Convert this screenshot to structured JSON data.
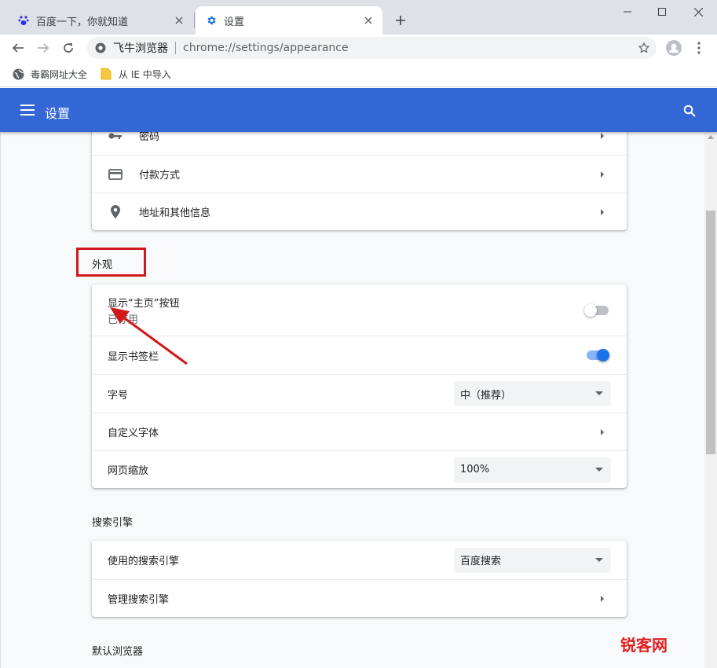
{
  "browser": {
    "tabs": [
      {
        "title": "百度一下，你就知道",
        "icon": "baidu-paw-icon",
        "active": false
      },
      {
        "title": "设置",
        "icon": "gear-icon",
        "active": true
      }
    ],
    "new_tab": "+",
    "omnibox": {
      "site_name": "飞牛浏览器",
      "url": "chrome://settings/appearance"
    },
    "bookmarks": [
      {
        "label": "毒霸网址大全",
        "icon": "globe-icon"
      },
      {
        "label": "从 IE 中导入",
        "icon": "folder-icon"
      }
    ]
  },
  "header": {
    "title": "设置",
    "accent_color": "#3367d6"
  },
  "autofill_card": {
    "rows": [
      {
        "label": "密码",
        "icon": "key-icon"
      },
      {
        "label": "付款方式",
        "icon": "credit-card-icon"
      },
      {
        "label": "地址和其他信息",
        "icon": "location-pin-icon"
      }
    ]
  },
  "appearance": {
    "section_title": "外观",
    "show_home_button": {
      "label": "显示“主页”按钮",
      "sublabel": "已停用",
      "enabled": false
    },
    "show_bookmarks_bar": {
      "label": "显示书签栏",
      "enabled": true
    },
    "font_size": {
      "label": "字号",
      "value": "中（推荐）"
    },
    "custom_fonts": {
      "label": "自定义字体"
    },
    "page_zoom": {
      "label": "网页缩放",
      "value": "100%"
    }
  },
  "search_engine": {
    "section_title": "搜索引擎",
    "engine": {
      "label": "使用的搜索引擎",
      "value": "百度搜索"
    },
    "manage": {
      "label": "管理搜索引擎"
    }
  },
  "default_browser": {
    "section_title": "默认浏览器"
  },
  "watermark": {
    "text": "锐客网"
  }
}
